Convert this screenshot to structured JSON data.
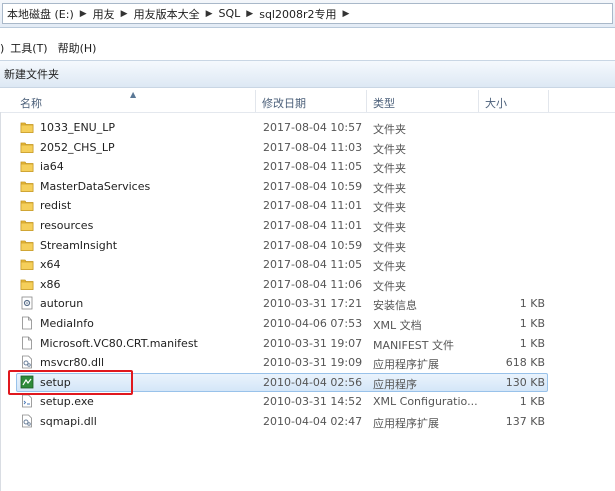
{
  "address_bar": {
    "crumbs": [
      "本地磁盘 (E:)",
      "用友",
      "用友版本大全",
      "SQL",
      "sql2008r2专用"
    ]
  },
  "menu": {
    "tools": "工具(T)",
    "help": "帮助(H)"
  },
  "toolbar": {
    "new_folder": "新建文件夹"
  },
  "columns": {
    "name": "名称",
    "date": "修改日期",
    "type": "类型",
    "size": "大小"
  },
  "files": [
    {
      "name": "1033_ENU_LP",
      "date": "2017-08-04 10:57",
      "type": "文件夹",
      "size": "",
      "icon": "folder-icon"
    },
    {
      "name": "2052_CHS_LP",
      "date": "2017-08-04 11:03",
      "type": "文件夹",
      "size": "",
      "icon": "folder-icon"
    },
    {
      "name": "ia64",
      "date": "2017-08-04 11:05",
      "type": "文件夹",
      "size": "",
      "icon": "folder-icon"
    },
    {
      "name": "MasterDataServices",
      "date": "2017-08-04 10:59",
      "type": "文件夹",
      "size": "",
      "icon": "folder-icon"
    },
    {
      "name": "redist",
      "date": "2017-08-04 11:01",
      "type": "文件夹",
      "size": "",
      "icon": "folder-icon"
    },
    {
      "name": "resources",
      "date": "2017-08-04 11:01",
      "type": "文件夹",
      "size": "",
      "icon": "folder-icon"
    },
    {
      "name": "StreamInsight",
      "date": "2017-08-04 10:59",
      "type": "文件夹",
      "size": "",
      "icon": "folder-icon"
    },
    {
      "name": "x64",
      "date": "2017-08-04 11:05",
      "type": "文件夹",
      "size": "",
      "icon": "folder-icon"
    },
    {
      "name": "x86",
      "date": "2017-08-04 11:06",
      "type": "文件夹",
      "size": "",
      "icon": "folder-icon"
    },
    {
      "name": "autorun",
      "date": "2010-03-31 17:21",
      "type": "安装信息",
      "size": "1 KB",
      "icon": "settings-file-icon"
    },
    {
      "name": "MediaInfo",
      "date": "2010-04-06 07:53",
      "type": "XML 文档",
      "size": "1 KB",
      "icon": "document-icon"
    },
    {
      "name": "Microsoft.VC80.CRT.manifest",
      "date": "2010-03-31 19:07",
      "type": "MANIFEST 文件",
      "size": "1 KB",
      "icon": "document-icon"
    },
    {
      "name": "msvcr80.dll",
      "date": "2010-03-31 19:09",
      "type": "应用程序扩展",
      "size": "618 KB",
      "icon": "dll-icon"
    },
    {
      "name": "setup",
      "date": "2010-04-04 02:56",
      "type": "应用程序",
      "size": "130 KB",
      "icon": "setup-app-icon",
      "selected": true
    },
    {
      "name": "setup.exe",
      "date": "2010-03-31 14:52",
      "type": "XML Configuratio...",
      "size": "1 KB",
      "icon": "config-file-icon"
    },
    {
      "name": "sqmapi.dll",
      "date": "2010-04-04 02:47",
      "type": "应用程序扩展",
      "size": "137 KB",
      "icon": "dll-icon"
    }
  ],
  "colors": {
    "folder": "#e8b93a",
    "selection": "#cfe3f7",
    "highlight_box": "#e0181e"
  }
}
